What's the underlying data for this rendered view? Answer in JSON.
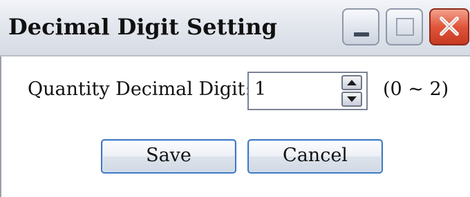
{
  "window": {
    "title": "Decimal Digit Setting"
  },
  "form": {
    "quantity_label": "Quantity Decimal Digit:",
    "quantity_value": "1",
    "range_text": "(0 ~ 2)"
  },
  "buttons": {
    "save_label": "Save",
    "cancel_label": "Cancel"
  },
  "icons": {
    "minimize": "minimize-icon",
    "maximize": "maximize-icon",
    "close": "close-icon",
    "spin_up": "arrow-up-icon",
    "spin_down": "arrow-down-icon"
  },
  "colors": {
    "close_button": "#e0553a",
    "button_border": "#3f79c2"
  }
}
